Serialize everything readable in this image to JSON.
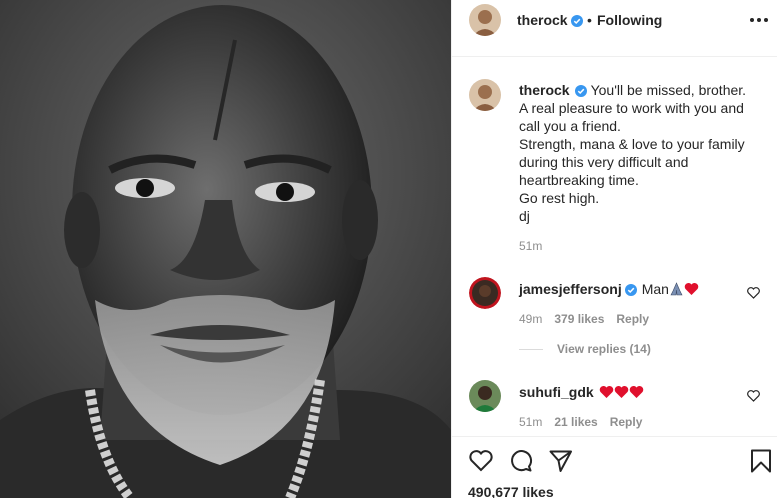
{
  "post": {
    "username": "therock",
    "follow_separator": "•",
    "follow_status": "Following",
    "caption_lines": "You'll be missed, brother.\nA real pleasure to work with you and call you a friend.\nStrength, mana & love to your family during this very difficult and heartbreaking time.\nGo rest high.\ndj",
    "caption_time": "51m",
    "likes": "490,677 likes"
  },
  "comments": [
    {
      "username": "jamesjeffersonj",
      "verified": true,
      "text": "Man",
      "emojis": [
        "folded-hands-icon",
        "red-heart-icon"
      ],
      "time": "49m",
      "likes": "379 likes",
      "reply": "Reply"
    },
    {
      "username": "suhufi_gdk",
      "verified": false,
      "text": "",
      "emojis": [
        "red-heart-icon",
        "red-heart-icon",
        "red-heart-icon"
      ],
      "time": "51m",
      "likes": "21 likes",
      "reply": "Reply"
    }
  ],
  "view_replies": "View replies (14)",
  "icons": {
    "verified": "verified-badge-icon",
    "more": "more-options-icon",
    "like": "heart-icon",
    "comment": "comment-icon",
    "share": "share-icon",
    "save": "bookmark-icon"
  },
  "colors": {
    "verified_blue": "#3897f0",
    "heart_red": "#ed4956",
    "muted_text": "#8e8e8e",
    "border": "#efefef"
  }
}
